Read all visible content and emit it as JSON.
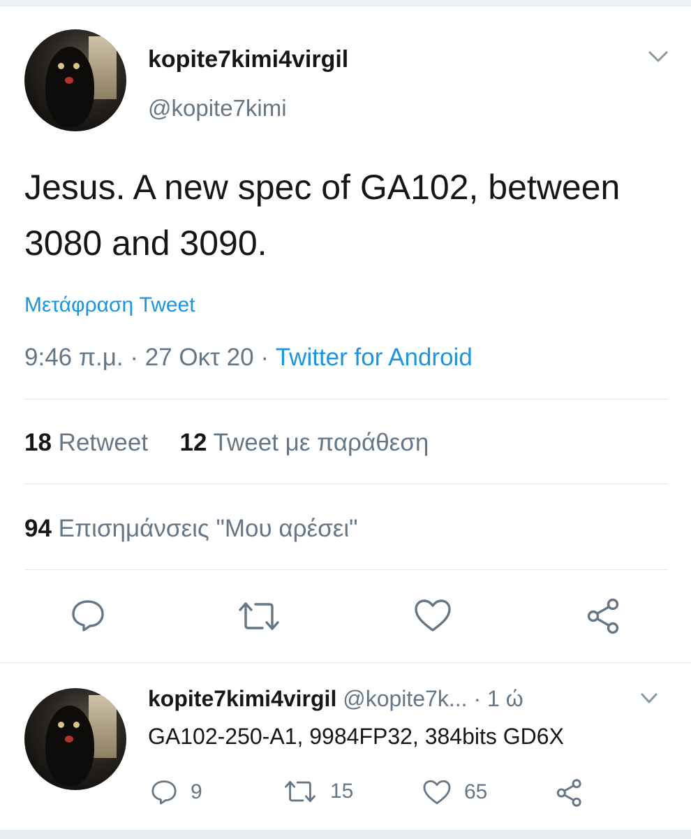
{
  "tweet": {
    "display_name": "kopite7kimi4virgil",
    "handle": "@kopite7kimi",
    "text": "Jesus. A new spec of GA102, between 3080 and 3090.",
    "translate_label": "Μετάφραση Tweet",
    "time": "9:46 π.μ.",
    "date": "27 Οκτ 20",
    "separator": "·",
    "source": "Twitter for Android",
    "retweets_count": "18",
    "retweets_label": "Retweet",
    "quotes_count": "12",
    "quotes_label": "Tweet με παράθεση",
    "likes_count": "94",
    "likes_label": "Επισημάνσεις \"Μου αρέσει\"",
    "actions": {
      "reply_icon": "reply-icon",
      "retweet_icon": "retweet-icon",
      "like_icon": "heart-icon",
      "share_icon": "share-icon"
    }
  },
  "reply": {
    "display_name": "kopite7kimi4virgil",
    "handle": "@kopite7k...",
    "separator": "·",
    "time": "1 ώ",
    "text": "GA102-250-A1, 9984FP32, 384bits GD6X",
    "reply_count": "9",
    "retweet_count": "15",
    "like_count": "65"
  },
  "colors": {
    "text": "#14171a",
    "secondary": "#657786",
    "link": "#1b95e0",
    "divider": "#e1e8ed"
  }
}
